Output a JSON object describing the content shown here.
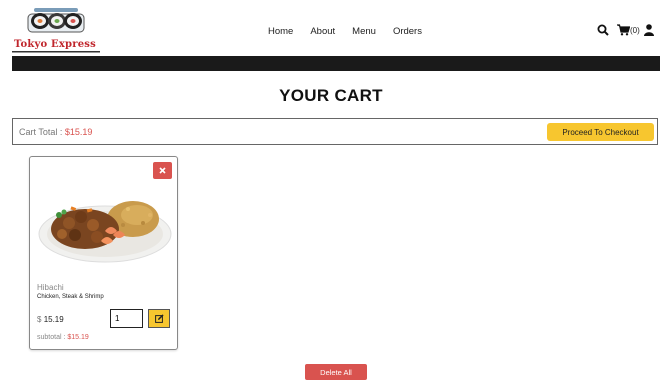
{
  "brand": {
    "name": "Tokyo Express"
  },
  "nav": {
    "items": [
      "Home",
      "About",
      "Menu",
      "Orders"
    ]
  },
  "header_icons": {
    "search": "search-icon",
    "cart": "cart-icon",
    "cart_count": "(0)",
    "user": "user-icon"
  },
  "page": {
    "title": "YOUR CART"
  },
  "cart_total": {
    "label": "Cart Total : ",
    "value": "$15.19",
    "checkout_label": "Proceed To Checkout"
  },
  "items": [
    {
      "name": "Hibachi",
      "description": "Chicken, Steak & Shrimp",
      "currency": "$",
      "price": "15.19",
      "quantity": "1",
      "subtotal_label": "subtotal : ",
      "subtotal_value": "$15.19"
    }
  ],
  "actions": {
    "delete_all": "Delete All"
  },
  "colors": {
    "accent_red": "#d9534f",
    "accent_yellow": "#f7c62f",
    "bar_black": "#1a1a1a"
  }
}
